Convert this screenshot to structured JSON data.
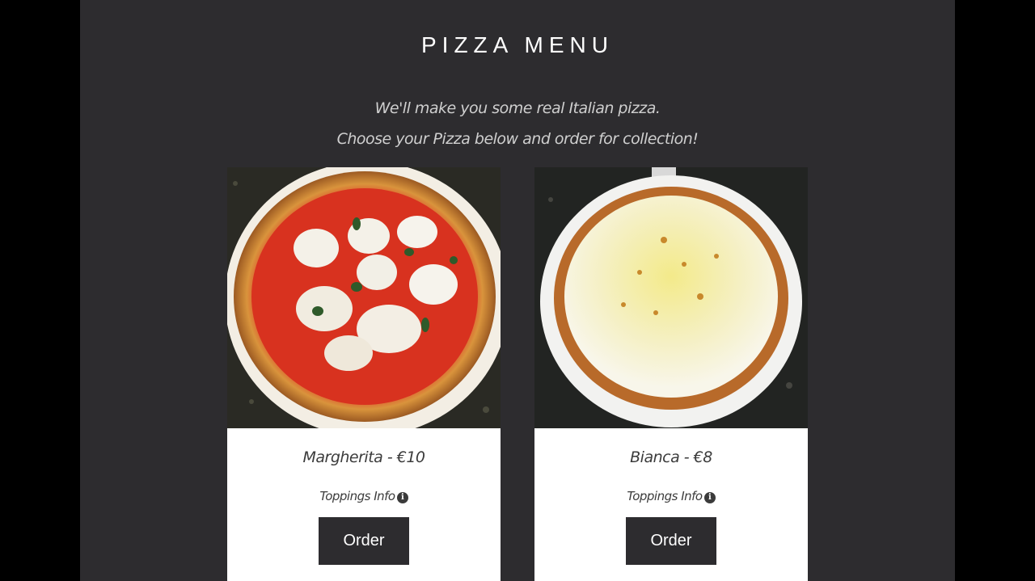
{
  "menu": {
    "title": "PIZZA MENU",
    "subtitle_line1": "We'll make you some real Italian pizza.",
    "subtitle_line2": "Choose your Pizza below and order for collection!"
  },
  "pizzas": [
    {
      "name": "Margherita - €10",
      "toppings_label": "Toppings Info",
      "order_label": "Order",
      "image": "margherita-photo"
    },
    {
      "name": "Bianca - €8",
      "toppings_label": "Toppings Info",
      "order_label": "Order",
      "image": "bianca-photo"
    }
  ],
  "icons": {
    "toppings_info": "info-icon"
  },
  "colors": {
    "background": "#2d2c2f",
    "outer": "#000000",
    "card": "#ffffff",
    "button": "#2d2c2f",
    "text_dark": "#3b3b3b",
    "text_light": "#cfcfcf"
  }
}
